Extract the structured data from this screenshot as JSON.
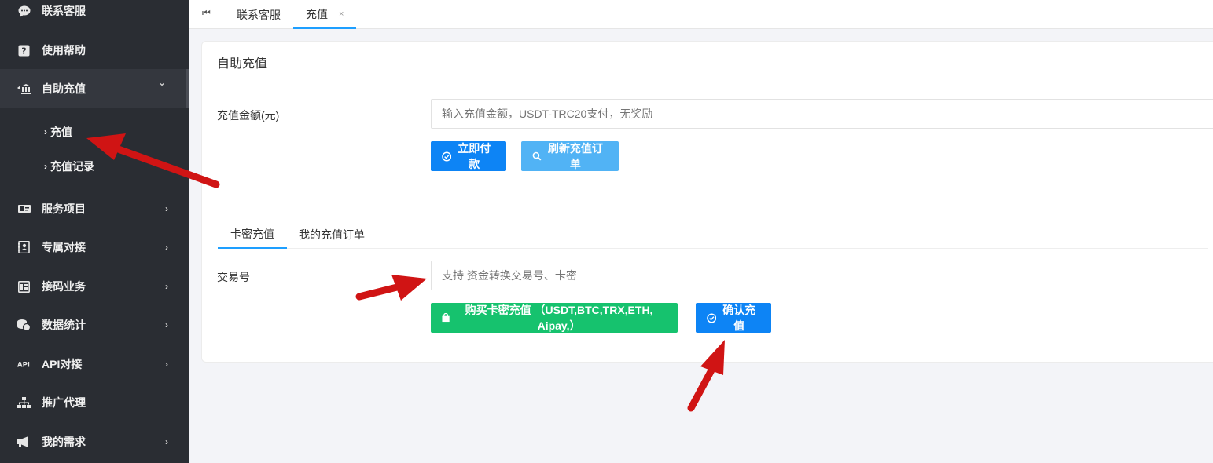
{
  "sidebar": {
    "items": [
      {
        "label": "联系客服",
        "icon": "chat-icon",
        "chevron": ""
      },
      {
        "label": "使用帮助",
        "icon": "help-icon",
        "chevron": ""
      },
      {
        "label": "自助充值",
        "icon": "bank-icon",
        "chevron": "⌄"
      },
      {
        "label": "服务项目",
        "icon": "id-card-icon",
        "chevron": "›"
      },
      {
        "label": "专属对接",
        "icon": "contacts-icon",
        "chevron": "›"
      },
      {
        "label": "接码业务",
        "icon": "sim-icon",
        "chevron": "›"
      },
      {
        "label": "数据统计",
        "icon": "coins-icon",
        "chevron": "›"
      },
      {
        "label": "API对接",
        "icon": "api-icon",
        "chevron": "›"
      },
      {
        "label": "推广代理",
        "icon": "sitemap-icon",
        "chevron": ""
      },
      {
        "label": "我的需求",
        "icon": "megaphone-icon",
        "chevron": "›"
      }
    ],
    "sub_items": [
      {
        "label": "充值"
      },
      {
        "label": "充值记录"
      }
    ]
  },
  "tabbar": {
    "home_icon": "⏮",
    "tabs": [
      {
        "label": "联系客服"
      },
      {
        "label": "充值",
        "close": "×"
      }
    ]
  },
  "card": {
    "title": "自助充值",
    "amount_label": "充值金额(元)",
    "amount_placeholder": "输入充值金额，USDT-TRC20支付，无奖励",
    "pay_button": "立即付款",
    "refresh_button": "刷新充值订单",
    "subtabs": [
      {
        "label": "卡密充值"
      },
      {
        "label": "我的充值订单"
      }
    ],
    "txn_label": "交易号",
    "txn_placeholder": "支持 资金转换交易号、卡密",
    "buy_button": "购买卡密充值 （USDT,BTC,TRX,ETH, Aipay,）",
    "confirm_button": "确认充值"
  },
  "colors": {
    "sidebar_bg": "#2a2d33",
    "primary_blue": "#0d84f5",
    "light_blue": "#51b3f5",
    "green": "#16c26e",
    "tab_underline": "#1e9fff",
    "annotation_arrow": "#d01414"
  }
}
